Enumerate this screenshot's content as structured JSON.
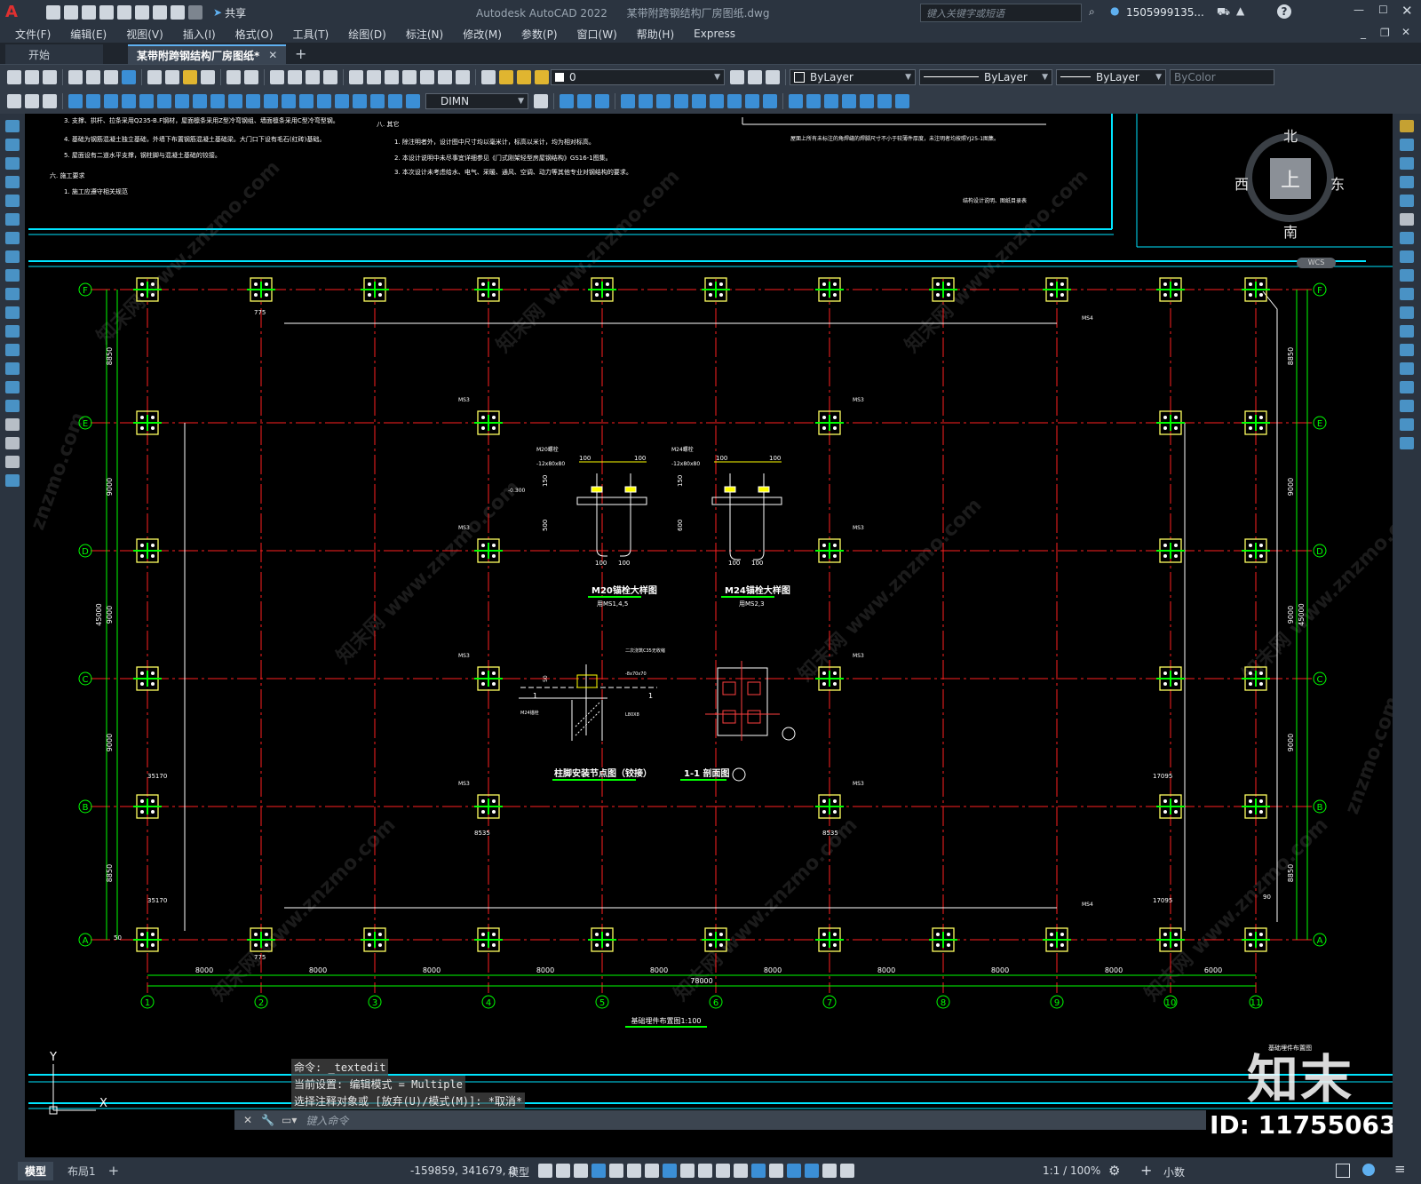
{
  "app": {
    "title": "Autodesk AutoCAD 2022",
    "document": "某带附跨钢结构厂房图纸.dwg",
    "search_placeholder": "键入关键字或短语",
    "user": "1505999135...",
    "share_label": "共享"
  },
  "menu": [
    "文件(F)",
    "编辑(E)",
    "视图(V)",
    "插入(I)",
    "格式(O)",
    "工具(T)",
    "绘图(D)",
    "标注(N)",
    "修改(M)",
    "参数(P)",
    "窗口(W)",
    "帮助(H)",
    "Express"
  ],
  "tabs": {
    "start": "开始",
    "active": "某带附跨钢结构厂房图纸*"
  },
  "toolbar": {
    "layer_value": "0",
    "color": "ByLayer",
    "linetype": "ByLayer",
    "lineweight": "ByLayer",
    "plotstyle": "ByColor",
    "dimstyle": "DIMN"
  },
  "viewcube": {
    "north": "北",
    "south": "南",
    "east": "东",
    "west": "西",
    "top": "上",
    "wcs": "WCS"
  },
  "notes": {
    "left": [
      "3. 支撑、拱杆、拉条采用Q235-B.F钢材，屋面檩条采用Z型冷弯钢组、墙面檩条采用C型冷弯型钢。",
      "4. 基础为钢筋混凝土独立基础，外墙下布置钢筋混凝土基础梁。大门口下设有毛石(红砖)基础。",
      "5. 屋面设有二道水平支撑，钢柱脚与混凝土基础的铰接。",
      "六. 施工要求",
      "1. 施工应遵守相关规范"
    ],
    "mid": [
      "八. 其它",
      "1. 除注明者外，设计图中尺寸均以毫米计，标高以米计，均为相对标高。",
      "2. 本设计说明中未尽事宜详细参见《门式刚架轻型房屋钢结构》GS16-1图集。",
      "3. 本次设计未考虑给水、电气、采暖、通风、空调、动力等其他专业对钢结构的要求。"
    ],
    "right1": "屋面上所有未标注的角焊缝的焊脚尺寸不小于较薄件厚度，未注明者均按照YJ25-1图集。",
    "right2": "结构设计说明、图纸目录表"
  },
  "plan": {
    "rows": [
      "F",
      "E",
      "D",
      "C",
      "B",
      "A"
    ],
    "cols": [
      "1",
      "2",
      "3",
      "4",
      "5",
      "6",
      "7",
      "8",
      "9",
      "10",
      "11"
    ],
    "col_spacings": [
      "8000",
      "8000",
      "8000",
      "8000",
      "8000",
      "8000",
      "8000",
      "8000",
      "8000",
      "6000"
    ],
    "total_length": "78000",
    "row_spacings": [
      "8850",
      "9000",
      "9000",
      "9000",
      "8850"
    ],
    "total_width": "45000",
    "title": "基础埋件布置图1:100",
    "bolt_labels": [
      "MS1",
      "MS2",
      "MS3",
      "MS4",
      "MS5"
    ],
    "dims_small": [
      "35170",
      "17095",
      "775",
      "8535",
      "10000",
      "50",
      "90"
    ],
    "details": {
      "m20_title": "M20锚栓大样图",
      "m20_sub": "用MS1,4,5",
      "m24_title": "M24锚栓大样图",
      "m24_sub": "用MS2,3",
      "base_title": "柱脚安装节点图（铰接）",
      "section_title": "1-1 剖面图",
      "d100": "100",
      "d150": "150",
      "d500": "500",
      "d600": "600",
      "d50": "50",
      "mark1": "1",
      "labels": [
        "M20螺栓",
        "-12x80x80",
        "M24螺栓",
        "L80X8",
        "-0.300",
        "二次浇筑C35无收缩",
        "-8x70x70",
        "M24锚栓"
      ]
    }
  },
  "sheet_stamp": "基础埋件布置图",
  "brand": {
    "logo": "知末",
    "id": "ID: 1175506394",
    "watermark": "znzmo.com",
    "watermark2": "知末网 www.znzmo.com"
  },
  "command": {
    "history": [
      "命令: _textedit",
      "当前设置: 编辑模式 = Multiple",
      "选择注释对象或 [放弃(U)/模式(M)]: *取消*"
    ],
    "placeholder": "键入命令"
  },
  "status": {
    "model_tab": "模型",
    "layout_tab": "布局1",
    "coords": "-159859, 341679, 0",
    "space": "模型",
    "scale": "1:1 / 100%",
    "units": "小数"
  },
  "colors": {
    "grid_red": "#ff2020",
    "element_green": "#00ff00",
    "text_yellow": "#ffff60",
    "frame_cyan": "#00e5ff",
    "ui_bg": "#2b3440"
  }
}
